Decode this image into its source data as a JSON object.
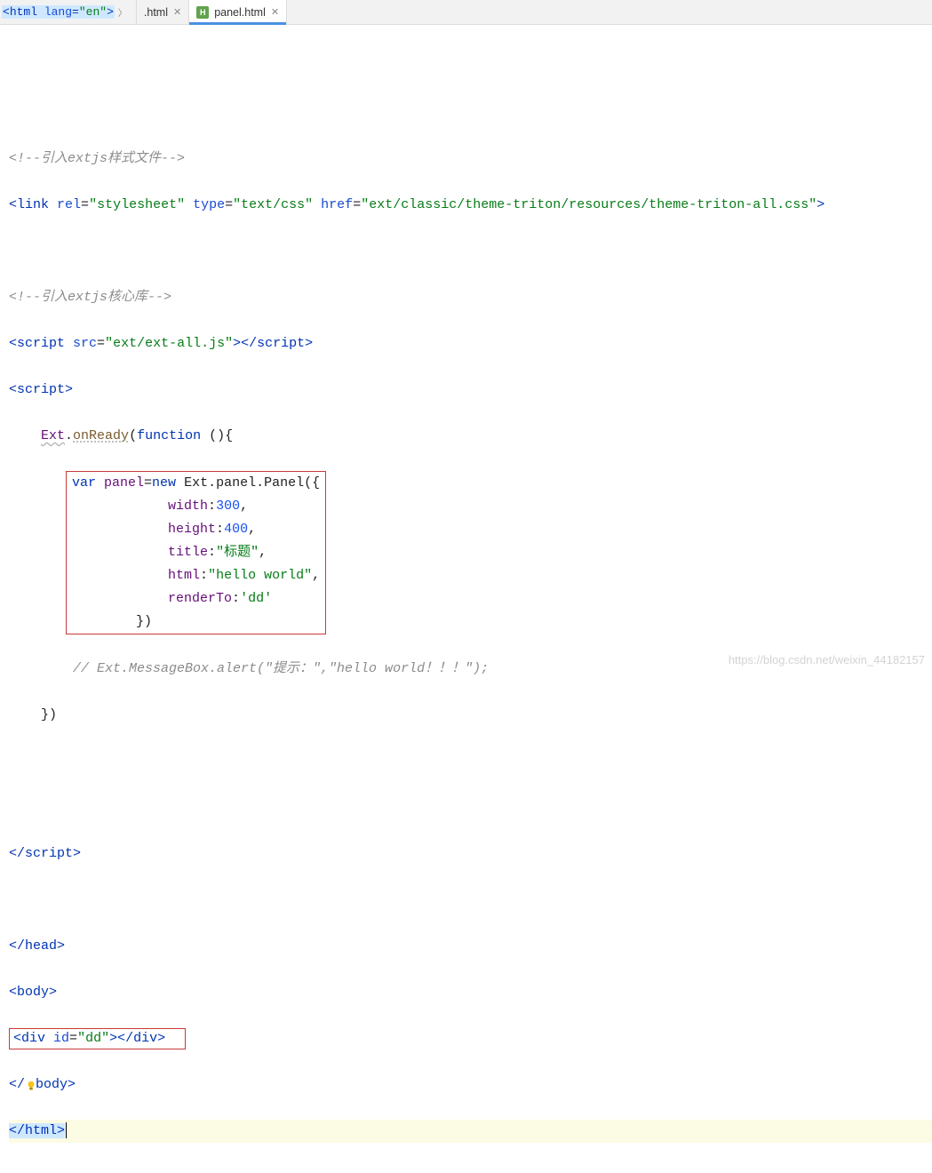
{
  "breadcrumb": {
    "raw": "<html lang=\"en\">"
  },
  "tabs": [
    {
      "label": ".html",
      "active": false,
      "icon": null
    },
    {
      "label": "panel.html",
      "active": true,
      "icon": "h-icon"
    }
  ],
  "code": {
    "c1": "<!--引入extjs样式文件-->",
    "linkOpen": "<",
    "linkTag": "link ",
    "linkAttrs": [
      {
        "name": "rel",
        "eq": "=",
        "val": "\"stylesheet\""
      },
      {
        "name": "type",
        "eq": "=",
        "val": "\"text/css\""
      },
      {
        "name": "href",
        "eq": "=",
        "val": "\"ext/classic/theme-triton/resources/theme-triton-all.css\""
      }
    ],
    "linkClose": ">",
    "c2": "<!--引入extjs核心库-->",
    "s1open": "<",
    "s1tag": "script ",
    "s1attr": {
      "name": "src",
      "eq": "=",
      "val": "\"ext/ext-all.js\""
    },
    "s1mid": "></",
    "s1tag2": "script",
    "s1end": ">",
    "s2open": "<",
    "s2tag": "script",
    "s2end": ">",
    "extObj": "Ext",
    "dot1": ".",
    "onReady": "onReady",
    "lparen": "(",
    "funcKw": "function ",
    "funcRest": "(){",
    "panelBlock": {
      "l1": {
        "indent": "        ",
        "kw": "var ",
        "name": "panel",
        "eq": "=",
        "newKw": "new ",
        "ns": "Ext.panel.Panel",
        "call": "({"
      },
      "l2": {
        "indent": "            ",
        "prop": "width",
        "colon": ":",
        "val": "300",
        "comma": ","
      },
      "l3": {
        "indent": "            ",
        "prop": "height",
        "colon": ":",
        "val": "400",
        "comma": ","
      },
      "l4": {
        "indent": "            ",
        "prop": "title",
        "colon": ":",
        "val": "\"标题\"",
        "comma": ","
      },
      "l5": {
        "indent": "            ",
        "prop": "html",
        "colon": ":",
        "val": "\"hello world\"",
        "comma": ","
      },
      "l6": {
        "indent": "            ",
        "prop": "renderTo",
        "colon": ":",
        "val": "'dd'"
      },
      "l7": {
        "indent": "        ",
        "close": "})"
      }
    },
    "c3": "        // Ext.MessageBox.alert(\"提示：\",\"hello world！！！\");",
    "closeFn": "    })",
    "s2close": "</",
    "s2tagc": "script",
    "s2closeend": ">",
    "headClose": {
      "a": "</",
      "b": "head",
      "c": ">"
    },
    "bodyOpen": {
      "a": "<",
      "b": "body",
      "c": ">"
    },
    "divLine": {
      "a": "<",
      "b": "div ",
      "attr": "id",
      "eq": "=",
      "val": "\"dd\"",
      "mid": "></",
      "b2": "div",
      "end": ">"
    },
    "bodyClose": {
      "a": "</",
      "b": "body",
      "c": ">"
    },
    "htmlClose": {
      "a": "</",
      "b": "html",
      "c": ">"
    }
  },
  "watermark": "https://blog.csdn.net/weixin_44182157"
}
